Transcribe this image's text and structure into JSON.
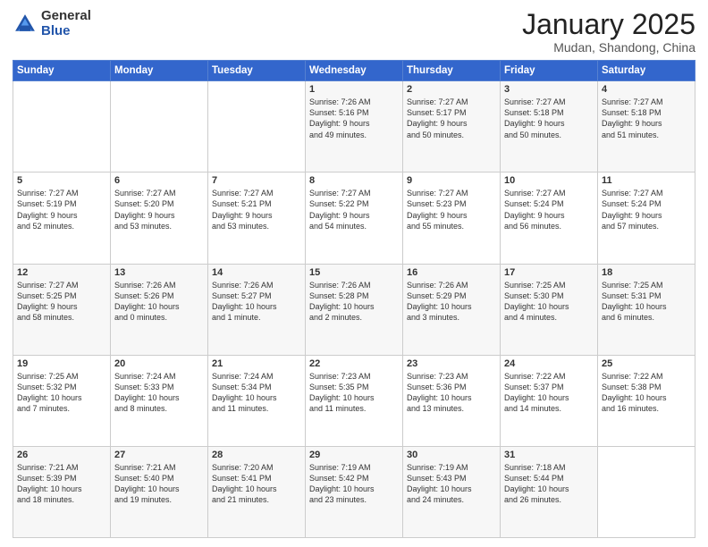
{
  "header": {
    "logo_general": "General",
    "logo_blue": "Blue",
    "title": "January 2025",
    "location": "Mudan, Shandong, China"
  },
  "days_of_week": [
    "Sunday",
    "Monday",
    "Tuesday",
    "Wednesday",
    "Thursday",
    "Friday",
    "Saturday"
  ],
  "weeks": [
    [
      {
        "day": "",
        "info": ""
      },
      {
        "day": "",
        "info": ""
      },
      {
        "day": "",
        "info": ""
      },
      {
        "day": "1",
        "info": "Sunrise: 7:26 AM\nSunset: 5:16 PM\nDaylight: 9 hours\nand 49 minutes."
      },
      {
        "day": "2",
        "info": "Sunrise: 7:27 AM\nSunset: 5:17 PM\nDaylight: 9 hours\nand 50 minutes."
      },
      {
        "day": "3",
        "info": "Sunrise: 7:27 AM\nSunset: 5:18 PM\nDaylight: 9 hours\nand 50 minutes."
      },
      {
        "day": "4",
        "info": "Sunrise: 7:27 AM\nSunset: 5:18 PM\nDaylight: 9 hours\nand 51 minutes."
      }
    ],
    [
      {
        "day": "5",
        "info": "Sunrise: 7:27 AM\nSunset: 5:19 PM\nDaylight: 9 hours\nand 52 minutes."
      },
      {
        "day": "6",
        "info": "Sunrise: 7:27 AM\nSunset: 5:20 PM\nDaylight: 9 hours\nand 53 minutes."
      },
      {
        "day": "7",
        "info": "Sunrise: 7:27 AM\nSunset: 5:21 PM\nDaylight: 9 hours\nand 53 minutes."
      },
      {
        "day": "8",
        "info": "Sunrise: 7:27 AM\nSunset: 5:22 PM\nDaylight: 9 hours\nand 54 minutes."
      },
      {
        "day": "9",
        "info": "Sunrise: 7:27 AM\nSunset: 5:23 PM\nDaylight: 9 hours\nand 55 minutes."
      },
      {
        "day": "10",
        "info": "Sunrise: 7:27 AM\nSunset: 5:24 PM\nDaylight: 9 hours\nand 56 minutes."
      },
      {
        "day": "11",
        "info": "Sunrise: 7:27 AM\nSunset: 5:24 PM\nDaylight: 9 hours\nand 57 minutes."
      }
    ],
    [
      {
        "day": "12",
        "info": "Sunrise: 7:27 AM\nSunset: 5:25 PM\nDaylight: 9 hours\nand 58 minutes."
      },
      {
        "day": "13",
        "info": "Sunrise: 7:26 AM\nSunset: 5:26 PM\nDaylight: 10 hours\nand 0 minutes."
      },
      {
        "day": "14",
        "info": "Sunrise: 7:26 AM\nSunset: 5:27 PM\nDaylight: 10 hours\nand 1 minute."
      },
      {
        "day": "15",
        "info": "Sunrise: 7:26 AM\nSunset: 5:28 PM\nDaylight: 10 hours\nand 2 minutes."
      },
      {
        "day": "16",
        "info": "Sunrise: 7:26 AM\nSunset: 5:29 PM\nDaylight: 10 hours\nand 3 minutes."
      },
      {
        "day": "17",
        "info": "Sunrise: 7:25 AM\nSunset: 5:30 PM\nDaylight: 10 hours\nand 4 minutes."
      },
      {
        "day": "18",
        "info": "Sunrise: 7:25 AM\nSunset: 5:31 PM\nDaylight: 10 hours\nand 6 minutes."
      }
    ],
    [
      {
        "day": "19",
        "info": "Sunrise: 7:25 AM\nSunset: 5:32 PM\nDaylight: 10 hours\nand 7 minutes."
      },
      {
        "day": "20",
        "info": "Sunrise: 7:24 AM\nSunset: 5:33 PM\nDaylight: 10 hours\nand 8 minutes."
      },
      {
        "day": "21",
        "info": "Sunrise: 7:24 AM\nSunset: 5:34 PM\nDaylight: 10 hours\nand 11 minutes."
      },
      {
        "day": "22",
        "info": "Sunrise: 7:23 AM\nSunset: 5:35 PM\nDaylight: 10 hours\nand 11 minutes."
      },
      {
        "day": "23",
        "info": "Sunrise: 7:23 AM\nSunset: 5:36 PM\nDaylight: 10 hours\nand 13 minutes."
      },
      {
        "day": "24",
        "info": "Sunrise: 7:22 AM\nSunset: 5:37 PM\nDaylight: 10 hours\nand 14 minutes."
      },
      {
        "day": "25",
        "info": "Sunrise: 7:22 AM\nSunset: 5:38 PM\nDaylight: 10 hours\nand 16 minutes."
      }
    ],
    [
      {
        "day": "26",
        "info": "Sunrise: 7:21 AM\nSunset: 5:39 PM\nDaylight: 10 hours\nand 18 minutes."
      },
      {
        "day": "27",
        "info": "Sunrise: 7:21 AM\nSunset: 5:40 PM\nDaylight: 10 hours\nand 19 minutes."
      },
      {
        "day": "28",
        "info": "Sunrise: 7:20 AM\nSunset: 5:41 PM\nDaylight: 10 hours\nand 21 minutes."
      },
      {
        "day": "29",
        "info": "Sunrise: 7:19 AM\nSunset: 5:42 PM\nDaylight: 10 hours\nand 23 minutes."
      },
      {
        "day": "30",
        "info": "Sunrise: 7:19 AM\nSunset: 5:43 PM\nDaylight: 10 hours\nand 24 minutes."
      },
      {
        "day": "31",
        "info": "Sunrise: 7:18 AM\nSunset: 5:44 PM\nDaylight: 10 hours\nand 26 minutes."
      },
      {
        "day": "",
        "info": ""
      }
    ]
  ]
}
